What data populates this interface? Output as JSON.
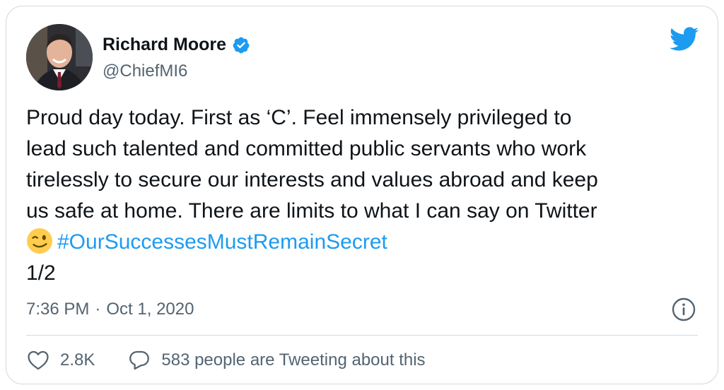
{
  "user": {
    "name": "Richard Moore",
    "handle": "@ChiefMI6"
  },
  "tweet": {
    "line1": "Proud day today. First as ‘C’. Feel immensely privileged to",
    "line2": "lead such talented and committed public servants who work",
    "line3": "tirelessly to secure our interests and values abroad and keep",
    "line4": "us safe at home. There are limits to what I can say on Twitter",
    "hashtag": "#OurSuccessesMustRemainSecret",
    "line6": "1/2",
    "emoji": "winking-face"
  },
  "meta": {
    "time": "7:36 PM",
    "separator": "·",
    "date": "Oct 1, 2020"
  },
  "actions": {
    "likes": "2.8K",
    "conversation": "583 people are Tweeting about this"
  },
  "colors": {
    "accent": "#1d9bf0",
    "text": "#0f1419",
    "muted": "#536471",
    "border": "#cfd9de"
  },
  "icons": [
    "verified-badge-icon",
    "twitter-bird-icon",
    "info-icon",
    "heart-icon",
    "reply-bubble-icon"
  ]
}
